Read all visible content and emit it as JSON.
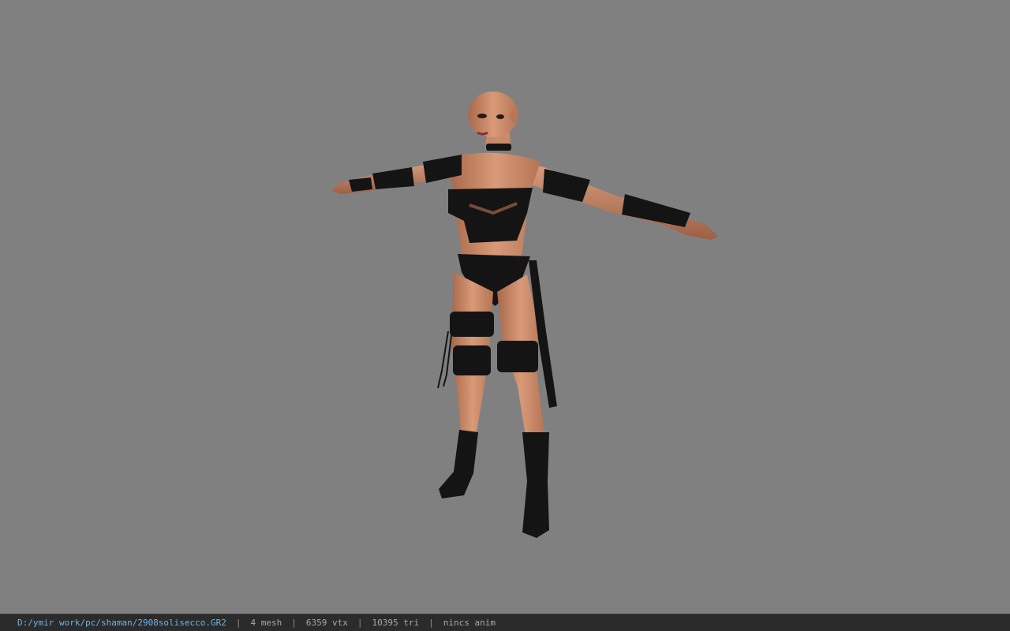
{
  "status_bar": {
    "file_path": "D:/ymir work/pc/shaman/2908solisecco.GR2",
    "mesh_count": "4 mesh",
    "vertex_count": "6359 vtx",
    "triangle_count": "10395 tri",
    "animation_status": "nincs anim",
    "separator": "|"
  },
  "colors": {
    "viewport_background": "#808080",
    "status_bar_background": "#2b2b2b",
    "path_text": "#6fb3e6",
    "status_text": "#a9a9a9"
  }
}
